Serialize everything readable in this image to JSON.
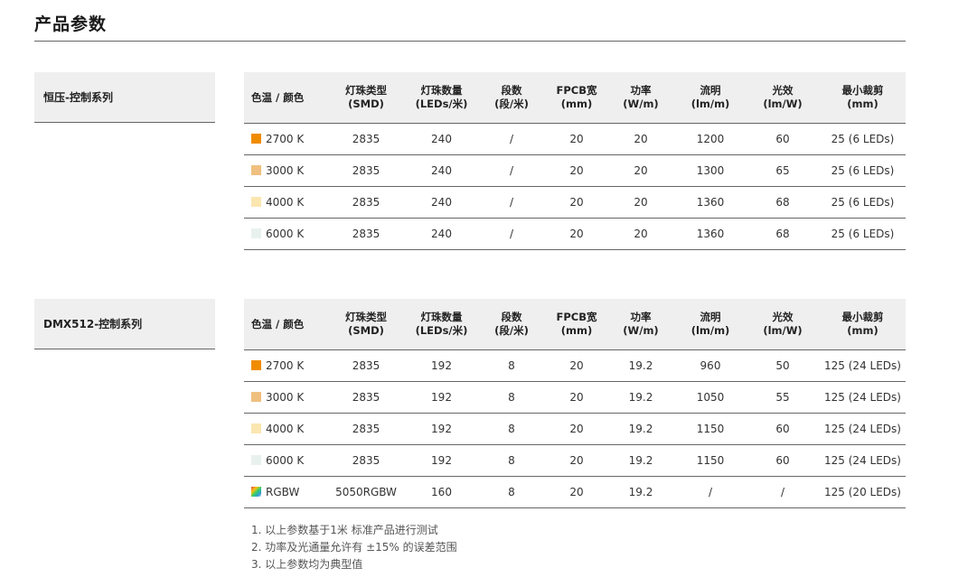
{
  "page": {
    "title": "产品参数"
  },
  "headers": [
    "色温 / 颜色",
    "灯珠类型\n(SMD)",
    "灯珠数量\n(LEDs/米)",
    "段数\n(段/米)",
    "FPCB宽\n(mm)",
    "功率\n(W/m)",
    "流明\n(lm/m)",
    "光效\n(lm/W)",
    "最小裁剪\n(mm)"
  ],
  "tables": [
    {
      "series": "恒压-控制系列",
      "rows": [
        {
          "swatch": "#f08c00",
          "cct": "2700 K",
          "smd": "2835",
          "leds": "240",
          "segments": "/",
          "fpcb": "20",
          "power": "20",
          "lumen": "1200",
          "efficacy": "60",
          "cut": "25 (6 LEDs)"
        },
        {
          "swatch": "#f0c080",
          "cct": "3000 K",
          "smd": "2835",
          "leds": "240",
          "segments": "/",
          "fpcb": "20",
          "power": "20",
          "lumen": "1300",
          "efficacy": "65",
          "cut": "25 (6 LEDs)"
        },
        {
          "swatch": "#fbe6b0",
          "cct": "4000 K",
          "smd": "2835",
          "leds": "240",
          "segments": "/",
          "fpcb": "20",
          "power": "20",
          "lumen": "1360",
          "efficacy": "68",
          "cut": "25 (6 LEDs)"
        },
        {
          "swatch": "#e8f1ee",
          "cct": "6000 K",
          "smd": "2835",
          "leds": "240",
          "segments": "/",
          "fpcb": "20",
          "power": "20",
          "lumen": "1360",
          "efficacy": "68",
          "cut": "25 (6 LEDs)"
        }
      ]
    },
    {
      "series": "DMX512-控制系列",
      "rows": [
        {
          "swatch": "#f08c00",
          "cct": "2700 K",
          "smd": "2835",
          "leds": "192",
          "segments": "8",
          "fpcb": "20",
          "power": "19.2",
          "lumen": "960",
          "efficacy": "50",
          "cut": "125 (24 LEDs)"
        },
        {
          "swatch": "#f0c080",
          "cct": "3000 K",
          "smd": "2835",
          "leds": "192",
          "segments": "8",
          "fpcb": "20",
          "power": "19.2",
          "lumen": "1050",
          "efficacy": "55",
          "cut": "125 (24 LEDs)"
        },
        {
          "swatch": "#fbe6b0",
          "cct": "4000 K",
          "smd": "2835",
          "leds": "192",
          "segments": "8",
          "fpcb": "20",
          "power": "19.2",
          "lumen": "1150",
          "efficacy": "60",
          "cut": "125 (24 LEDs)"
        },
        {
          "swatch": "#e8f1ee",
          "cct": "6000 K",
          "smd": "2835",
          "leds": "192",
          "segments": "8",
          "fpcb": "20",
          "power": "19.2",
          "lumen": "1150",
          "efficacy": "60",
          "cut": "125 (24 LEDs)"
        },
        {
          "swatch": "rgbw",
          "cct": "RGBW",
          "smd": "5050RGBW",
          "leds": "160",
          "segments": "8",
          "fpcb": "20",
          "power": "19.2",
          "lumen": "/",
          "efficacy": "/",
          "cut": "125 (20 LEDs)"
        }
      ]
    }
  ],
  "notes": [
    "1. 以上参数基于1米 标准产品进行测试",
    "2. 功率及光通量允许有 ±15% 的误差范围",
    "3. 以上参数均为典型值"
  ]
}
